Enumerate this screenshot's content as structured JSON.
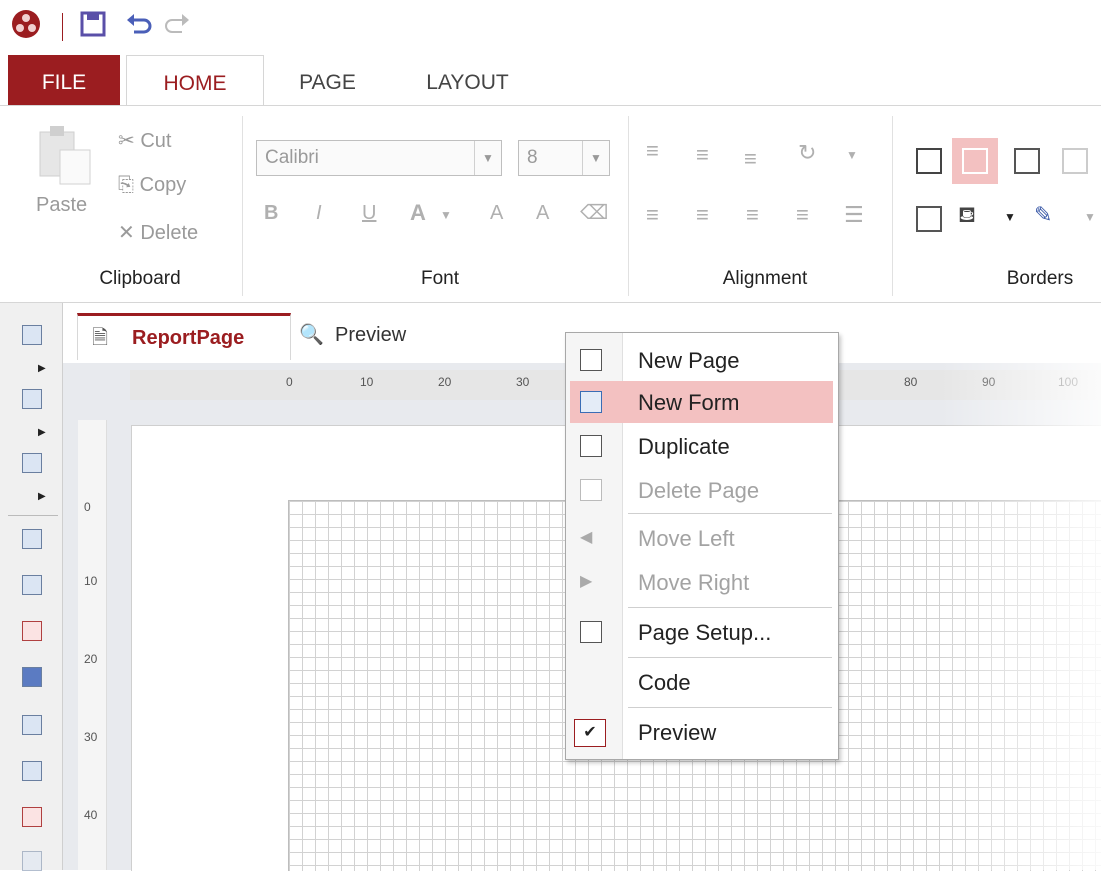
{
  "quick_access": {
    "logo_icon": "app-logo-icon",
    "save_icon": "save-icon",
    "undo_icon": "undo-icon",
    "redo_icon": "redo-icon"
  },
  "ribbon_tabs": {
    "file": "FILE",
    "home": "HOME",
    "page": "PAGE",
    "layout": "LAYOUT"
  },
  "clipboard": {
    "paste": "Paste",
    "cut": "Cut",
    "copy": "Copy",
    "delete": "Delete",
    "group_label": "Clipboard"
  },
  "font": {
    "family": "Calibri",
    "size": "8",
    "bold": "B",
    "italic": "I",
    "underline": "U",
    "color": "A",
    "grow": "A",
    "shrink": "A",
    "group_label": "Font"
  },
  "alignment": {
    "group_label": "Alignment"
  },
  "borders": {
    "group_label": "Borders"
  },
  "doc_tabs": {
    "report_page": "ReportPage",
    "preview": "Preview"
  },
  "ruler": {
    "h_ticks": [
      "0",
      "10",
      "20",
      "30",
      "80",
      "90",
      "100"
    ],
    "v_ticks": [
      "0",
      "10",
      "20",
      "30",
      "40"
    ]
  },
  "context_menu": {
    "items": [
      {
        "label": "New Page",
        "icon": "new-page-icon",
        "enabled": true
      },
      {
        "label": "New Form",
        "icon": "new-form-icon",
        "enabled": true,
        "highlighted": true
      },
      {
        "label": "Duplicate",
        "icon": "duplicate-icon",
        "enabled": true
      },
      {
        "label": "Delete Page",
        "icon": "delete-page-icon",
        "enabled": false
      },
      {
        "label": "Move Left",
        "icon": "move-left-icon",
        "enabled": false
      },
      {
        "label": "Move Right",
        "icon": "move-right-icon",
        "enabled": false
      },
      {
        "label": "Page Setup...",
        "icon": "page-setup-icon",
        "enabled": true
      },
      {
        "label": "Code",
        "icon": "",
        "enabled": true
      },
      {
        "label": "Preview",
        "icon": "check-icon",
        "enabled": true,
        "checked": true
      }
    ]
  },
  "colors": {
    "accent": "#9b1d20",
    "highlight": "#f3c1c1"
  }
}
